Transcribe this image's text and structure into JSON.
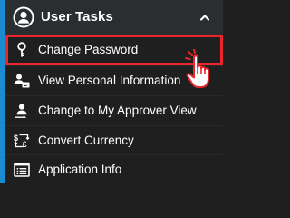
{
  "header": {
    "title": "User Tasks",
    "icon": "user-circle-icon",
    "toggle_icon": "chevron-up-icon"
  },
  "menu": {
    "items": [
      {
        "label": "Change Password",
        "icon": "key-icon",
        "highlighted": true
      },
      {
        "label": "View Personal Information",
        "icon": "user-card-icon",
        "highlighted": false
      },
      {
        "label": "Change to My Approver View",
        "icon": "user-switch-icon",
        "highlighted": false
      },
      {
        "label": "Convert Currency",
        "icon": "currency-exchange-icon",
        "highlighted": false
      },
      {
        "label": "Application Info",
        "icon": "list-window-icon",
        "highlighted": false
      }
    ]
  },
  "pointer": {
    "icon": "hand-pointer-icon"
  },
  "colors": {
    "background": "#1f1f1f",
    "header_bg": "#2b2e31",
    "accent": "#1b8bd1",
    "highlight_border": "#e8262b",
    "text": "#ffffff"
  }
}
